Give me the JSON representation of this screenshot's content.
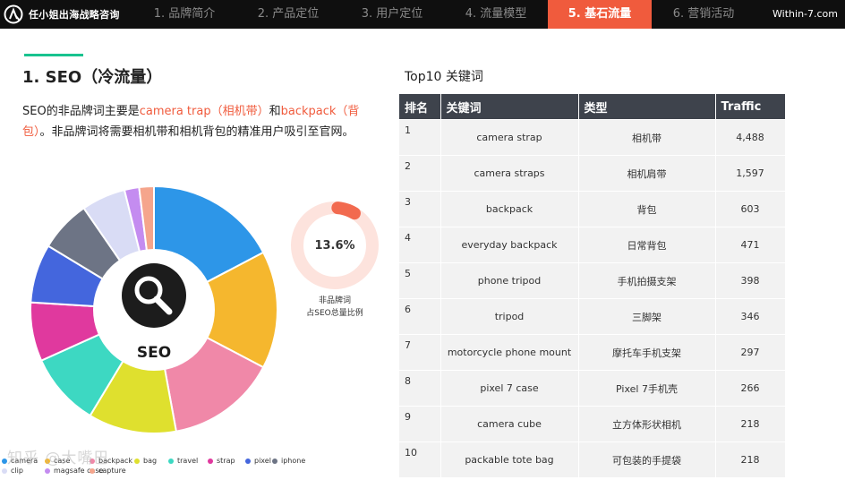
{
  "header": {
    "brand_name": "任小姐出海战略咨询",
    "site": "Within-7.com",
    "tabs": [
      {
        "label": "1. 品牌简介",
        "active": false
      },
      {
        "label": "2. 产品定位",
        "active": false
      },
      {
        "label": "3. 用户定位",
        "active": false
      },
      {
        "label": "4. 流量模型",
        "active": false
      },
      {
        "label": "5. 基石流量",
        "active": true
      },
      {
        "label": "6. 营销活动",
        "active": false
      }
    ],
    "accent_color": "#f05b3d"
  },
  "section": {
    "title": "1. SEO（冷流量）",
    "desc_prefix": "SEO的非品牌词主要是",
    "kw1": "camera trap（相机带）",
    "mid": "和",
    "kw2": "backpack（背包）",
    "desc_suffix": "。非品牌词将需要相机带和相机背包的精准用户吸引至官网。"
  },
  "donut": {
    "center_label": "SEO",
    "icon": "search-icon"
  },
  "ring": {
    "value": "13.6%",
    "fraction": 0.136,
    "caption_line1": "非品牌词",
    "caption_line2": "占SEO总量比例",
    "color": "#f26a4f",
    "track_color": "#fde3dd"
  },
  "chart_data": {
    "type": "pie",
    "categories": [
      "camera",
      "case",
      "backpack",
      "bag",
      "travel",
      "strap",
      "pixel",
      "iphone",
      "clip",
      "magsafe case",
      "capture"
    ],
    "values": [
      18,
      16,
      15,
      12,
      10,
      8,
      8,
      7,
      6,
      2,
      2
    ],
    "colors": [
      "#2d96e8",
      "#f5b72e",
      "#f088a8",
      "#dfe02e",
      "#3dd8c2",
      "#e0399e",
      "#4466dd",
      "#6d7485",
      "#d9dcf5",
      "#c48cf0",
      "#f5a58c"
    ],
    "legend_position": "bottom"
  },
  "table": {
    "title": "Top10 关键词",
    "headers": [
      "排名",
      "关键词",
      "类型",
      "Traffic"
    ],
    "rows": [
      [
        "1",
        "camera strap",
        "相机带",
        "4,488"
      ],
      [
        "2",
        "camera straps",
        "相机肩带",
        "1,597"
      ],
      [
        "3",
        "backpack",
        "背包",
        "603"
      ],
      [
        "4",
        "everyday backpack",
        "日常背包",
        "471"
      ],
      [
        "5",
        "phone tripod",
        "手机拍摄支架",
        "398"
      ],
      [
        "6",
        "tripod",
        "三脚架",
        "346"
      ],
      [
        "7",
        "motorcycle phone mount",
        "摩托车手机支架",
        "297"
      ],
      [
        "8",
        "pixel 7 case",
        "Pixel 7手机壳",
        "266"
      ],
      [
        "9",
        "camera cube",
        "立方体形状相机",
        "218"
      ],
      [
        "10",
        "packable tote bag",
        "可包装的手提袋",
        "218"
      ]
    ]
  },
  "watermark": "知乎 @大嘴巴"
}
